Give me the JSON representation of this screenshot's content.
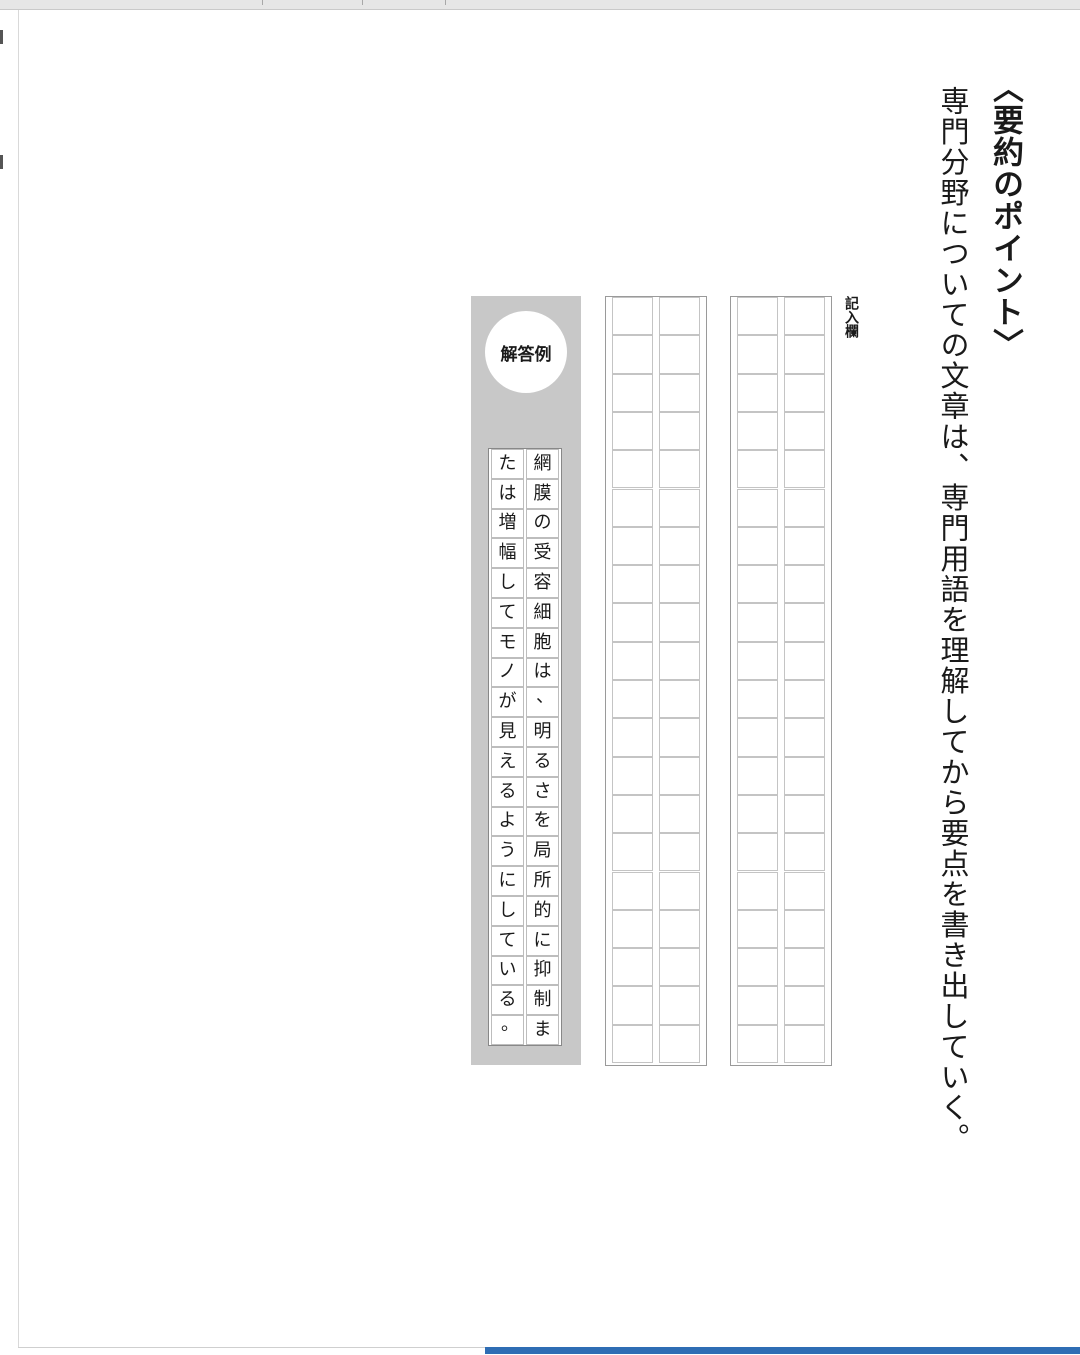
{
  "heading": "〈要約のポイント〉",
  "lead": "専門分野についての文章は、専門用語を理解してから要点を書き出していく。",
  "answer_area_label": "記入欄",
  "example": {
    "badge": "解答例",
    "lines": [
      "網膜の受容細胞は、明るさを局所的に抑制ま",
      "たは増幅してモノが見えるようにしている。"
    ]
  },
  "progress_fraction": 0.56
}
